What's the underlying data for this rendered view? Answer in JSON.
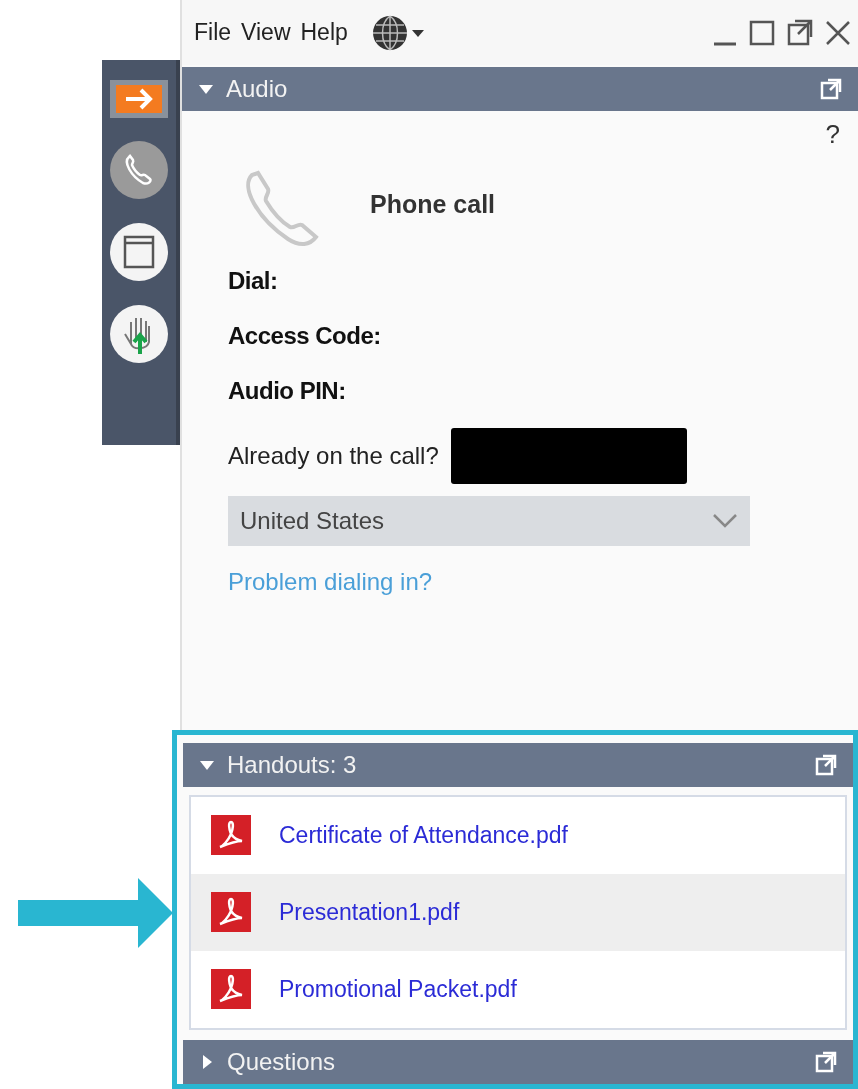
{
  "menu": [
    "File",
    "View",
    "Help"
  ],
  "audio": {
    "title": "Audio",
    "expanded": true,
    "help": "?",
    "phone_label": "Phone call",
    "fields": [
      "Dial:",
      "Access Code:",
      "Audio PIN:"
    ],
    "already_label": "Already on the call?",
    "country": "United States",
    "problem_link": "Problem dialing in?"
  },
  "handouts": {
    "title": "Handouts: 3",
    "expanded": true,
    "items": [
      {
        "name": "Certificate of Attendance.pdf",
        "selected": false
      },
      {
        "name": "Presentation1.pdf",
        "selected": true
      },
      {
        "name": "Promotional Packet.pdf",
        "selected": false
      }
    ]
  },
  "questions": {
    "title": "Questions",
    "expanded": false
  }
}
